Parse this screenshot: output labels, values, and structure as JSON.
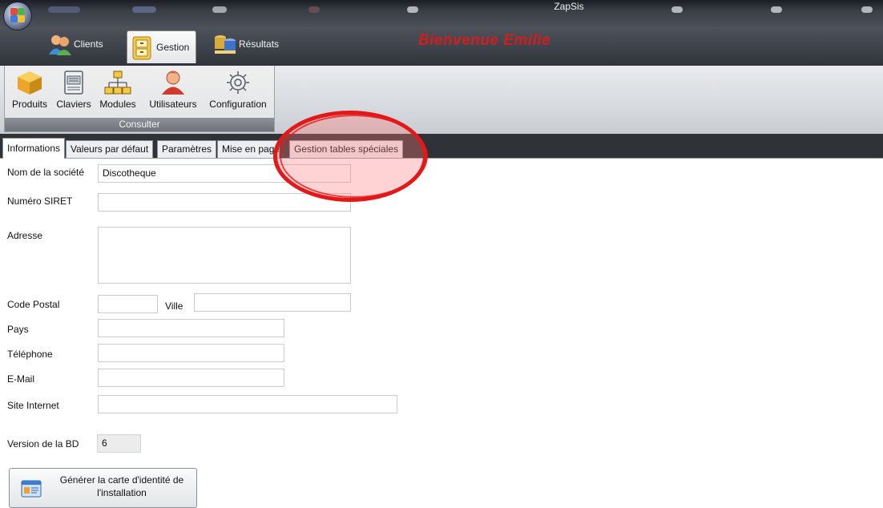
{
  "window": {
    "title": "ZapSis"
  },
  "ribbon_tabs": [
    {
      "label": "Clients",
      "icon": "clients-icon"
    },
    {
      "label": "Gestion",
      "icon": "cabinet-icon",
      "active": true
    },
    {
      "label": "Résultats",
      "icon": "results-icon"
    }
  ],
  "welcome": "Bienvenue Emilie",
  "ribbon": {
    "buttons": [
      {
        "label": "Produits",
        "icon": "box-icon"
      },
      {
        "label": "Claviers",
        "icon": "keyboard-icon"
      },
      {
        "label": "Modules",
        "icon": "modules-icon"
      },
      {
        "label": "Utilisateurs",
        "icon": "user-icon"
      },
      {
        "label": "Configuration",
        "icon": "gear-icon"
      }
    ],
    "group_label": "Consulter"
  },
  "tabs": [
    {
      "label": "Informations",
      "active": true
    },
    {
      "label": "Valeurs par défaut"
    },
    {
      "label": "Paramètres"
    },
    {
      "label": "Mise en page"
    },
    {
      "label": "Gestion tables spéciales"
    }
  ],
  "form": {
    "societe": {
      "label": "Nom de la société",
      "value": "Discotheque"
    },
    "siret": {
      "label": "Numéro SIRET",
      "value": ""
    },
    "adresse": {
      "label": "Adresse",
      "value": ""
    },
    "code_postal": {
      "label": "Code Postal",
      "value": ""
    },
    "ville": {
      "label": "Ville",
      "value": ""
    },
    "pays": {
      "label": "Pays",
      "value": ""
    },
    "telephone": {
      "label": "Téléphone",
      "value": ""
    },
    "email": {
      "label": "E-Mail",
      "value": ""
    },
    "site": {
      "label": "Site Internet",
      "value": ""
    },
    "version": {
      "label": "Version de la BD",
      "value": "6"
    }
  },
  "generate_button": {
    "line1": "Générer la carte d'identité de",
    "line2": "l'installation"
  },
  "colors": {
    "welcome": "#d41c1c",
    "annotation": "#e31919"
  }
}
